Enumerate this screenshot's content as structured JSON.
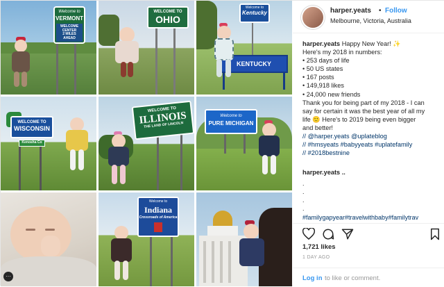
{
  "header": {
    "username": "harper.yeats",
    "separator": "•",
    "follow_label": "Follow",
    "location": "Melbourne, Victoria, Australia"
  },
  "tiles": {
    "vermont": {
      "line1": "Welcome to",
      "line2": "VERMONT",
      "line3": "WELCOME CENTER",
      "line4": "2 MILES AHEAD"
    },
    "ohio": {
      "line1": "WELCOME TO",
      "line2": "OHIO"
    },
    "kentucky": {
      "line1": "Welcome to",
      "line2": "Kentucky",
      "bench": "KENTUCKY"
    },
    "wisconsin": {
      "line1": "WELCOME TO",
      "line2": "WISCONSIN",
      "line3": "Kenosha Co"
    },
    "illinois": {
      "line1": "WELCOME TO",
      "line2": "ILLINOIS",
      "line3": "THE LAND OF LINCOLN"
    },
    "michigan": {
      "line1": "Welcome to",
      "line2": "PURE MICHIGAN"
    },
    "indiana": {
      "line1": "Welcome to",
      "line2": "Indiana",
      "line3": "Crossroads of America"
    }
  },
  "caption": {
    "username": "harper.yeats",
    "line1": " Happy New Year! ✨",
    "line2": "Here's my 2018 in numbers:",
    "stats": [
      "• 253 days of life",
      "• 50 US states",
      "• 167 posts",
      "• 149,918 likes",
      "• 24,000 new friends"
    ],
    "thanks1": "Thank you for being part of my 2018 - I can",
    "thanks2": "say for certain it was the best year of all my",
    "thanks3": "life 🙂 Here's to 2019 being even bigger",
    "thanks4": "and better!",
    "credit1": "// @harper.yeats @uplateblog",
    "credit2": "// #hmsyeats #babyyeats #uplatefamily",
    "credit3": "// #2018bestnine"
  },
  "comment_user": "harper.yeats ..",
  "dots": [
    ".",
    ".",
    ".",
    "."
  ],
  "hashtags": "#familygapyear#travelwithbaby#familytrav",
  "likes": "1,721 likes",
  "time_ago": "1 DAY AGO",
  "footer": {
    "login_label": "Log in",
    "rest": "to like or comment."
  },
  "icons": [
    "heart-icon",
    "comment-icon",
    "share-icon",
    "bookmark-icon",
    "more-icon"
  ],
  "colors": {
    "follow": "#3897f0",
    "hashtag": "#003569",
    "text": "#262626",
    "muted": "#999999"
  }
}
